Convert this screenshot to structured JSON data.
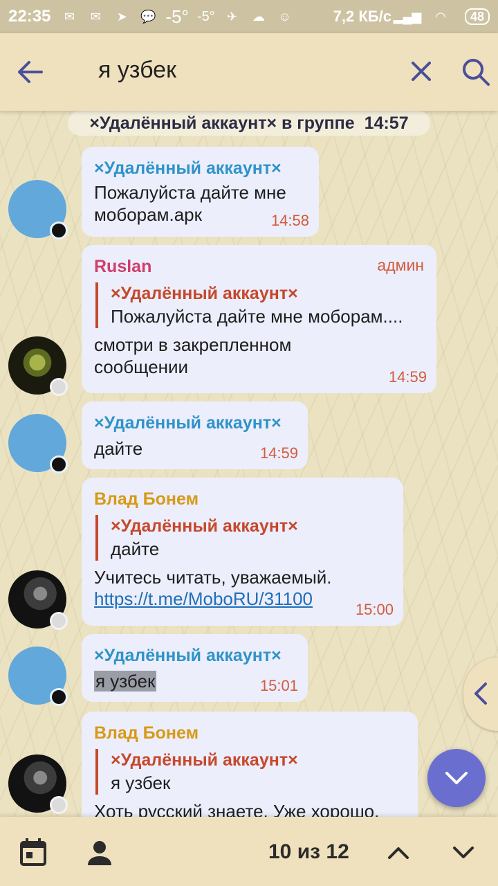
{
  "status_bar": {
    "time": "22:35",
    "weather_temp": "-5°",
    "weather_temp_small": "-5°",
    "net_speed": "7,2 КБ/с",
    "battery": "48"
  },
  "search_bar": {
    "query": "я узбек"
  },
  "chat": {
    "service_message": {
      "text": "×Удалённый аккаунт× в группе",
      "time": "14:57"
    },
    "messages": [
      {
        "sender": "×Удалённый аккаунт×",
        "text_line1": "Пожалуйста дайте мне",
        "text_line2": "моборам.арк",
        "time": "14:58"
      },
      {
        "sender": "Ruslan",
        "role": "админ",
        "quote_sender": "×Удалённый аккаунт×",
        "quote_text": "Пожалуйста дайте мне моборам....",
        "text_line1": "смотри в закрепленном",
        "text_line2": "сообщении",
        "time": "14:59"
      },
      {
        "sender": "×Удалённый аккаунт×",
        "text": "дайте",
        "time": "14:59"
      },
      {
        "sender": "Влад Бонем",
        "quote_sender": "×Удалённый аккаунт×",
        "quote_text": "дайте",
        "text": "Учитесь читать, уважаемый.",
        "link": "https://t.me/MoboRU/31100",
        "time": "15:00"
      },
      {
        "sender": "×Удалённый аккаунт×",
        "text": "я узбек",
        "time": "15:01"
      },
      {
        "sender": "Влад Бонем",
        "quote_sender": "×Удалённый аккаунт×",
        "quote_text": "я узбек",
        "text": "Хоть русский знаете. Уже хорошо."
      }
    ]
  },
  "bottom_bar": {
    "counter": "10 из 12"
  },
  "colors": {
    "bar_bg": "#efe1bd",
    "bubble_bg": "#eceefb",
    "sender_blue": "#2f93c9",
    "sender_ruslan": "#cf3f6c",
    "sender_vlad": "#d79a17",
    "quote_accent": "#c6482c",
    "time_color": "#d35b3d",
    "fab_bg": "#6a6fcf"
  }
}
